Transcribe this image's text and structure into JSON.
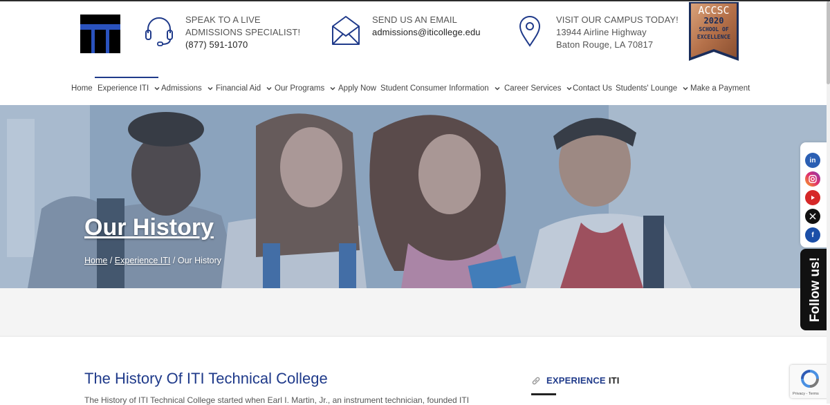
{
  "header": {
    "phone": {
      "line1": "SPEAK TO A LIVE",
      "line2": "ADMISSIONS SPECIALIST!",
      "line3": "(877) 591-1070"
    },
    "email": {
      "line1": "SEND US AN EMAIL",
      "line2": "admissions@iticollege.edu"
    },
    "campus": {
      "line1": "VISIT OUR CAMPUS TODAY!",
      "line2": "13944 Airline Highway",
      "line3": "Baton Rouge, LA 70817"
    },
    "badge": {
      "line1": "ACCSC",
      "line2": "2020",
      "line3": "SCHOOL OF",
      "line4": "EXCELLENCE"
    }
  },
  "nav": {
    "items": [
      {
        "label": "Home"
      },
      {
        "label": "Experience ITI"
      },
      {
        "label": "Admissions"
      },
      {
        "label": "Financial Aid"
      },
      {
        "label": "Our Programs"
      },
      {
        "label": "Apply Now"
      },
      {
        "label": "Student Consumer Information"
      },
      {
        "label": "Career Services"
      },
      {
        "label": "Contact Us"
      },
      {
        "label": "Students' Lounge"
      },
      {
        "label": "Make a Payment"
      }
    ]
  },
  "hero": {
    "title": "Our History",
    "breadcrumb": {
      "home": "Home",
      "sep1": "/",
      "parent": "Experience ITI",
      "sep2": "/",
      "current": "Our History"
    }
  },
  "content": {
    "title": "The History Of ITI Technical College",
    "text": "The History of ITI Technical College started when Earl I. Martin, Jr., an instrument technician, founded ITI"
  },
  "sidebar": {
    "heading_a": "EXPERIENCE",
    "heading_b": "ITI"
  },
  "social": {
    "follow_label": "Follow us!"
  },
  "recaptcha": {
    "text": "Privacy - Terms"
  },
  "colors": {
    "brand_blue": "#1f3a8a",
    "hero_overlay": "#5b7ba0"
  }
}
